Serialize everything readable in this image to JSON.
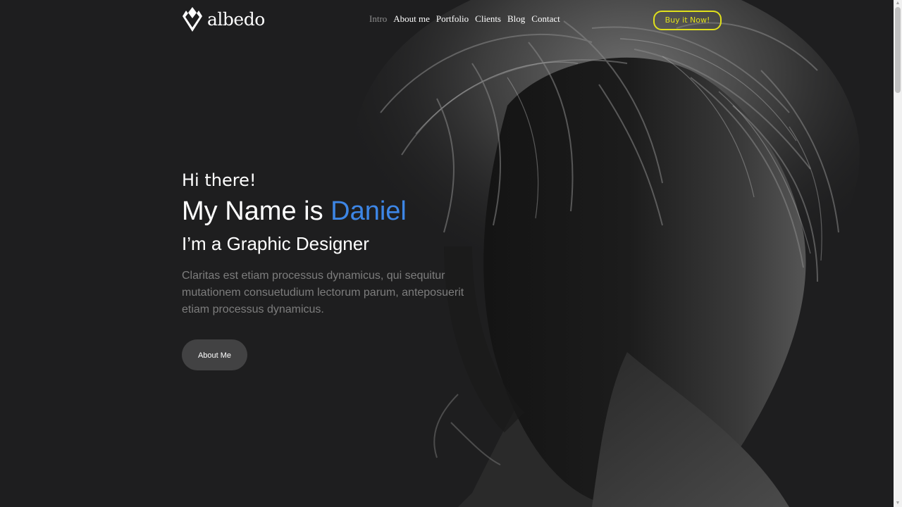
{
  "brand": {
    "name": "albedo"
  },
  "nav": {
    "items": [
      {
        "label": "Intro",
        "active": true
      },
      {
        "label": "About me"
      },
      {
        "label": "Portfolio"
      },
      {
        "label": "Clients"
      },
      {
        "label": "Blog"
      },
      {
        "label": "Contact"
      }
    ]
  },
  "header": {
    "buy_label": "Buy it Now!"
  },
  "hero": {
    "greeting": "Hi there!",
    "title_prefix": "My Name is",
    "title_name": "Daniel",
    "subtitle": "I’m a Graphic Designer",
    "description": "Claritas est etiam processus dynamicus, qui sequitur mutationem consuetudium lectorum parum, anteposuerit etiam processus dynamicus.",
    "button_label": "About Me"
  },
  "colors": {
    "background": "#1e1e1f",
    "accent": "#3d86e6",
    "buy_button": "#e0e01c",
    "button_bg": "#424243",
    "muted_text": "#7d7d7d"
  },
  "icons": {
    "logo": "albedo-diamond-logo",
    "scroll_up": "triangle-up",
    "scroll_down": "triangle-down"
  }
}
